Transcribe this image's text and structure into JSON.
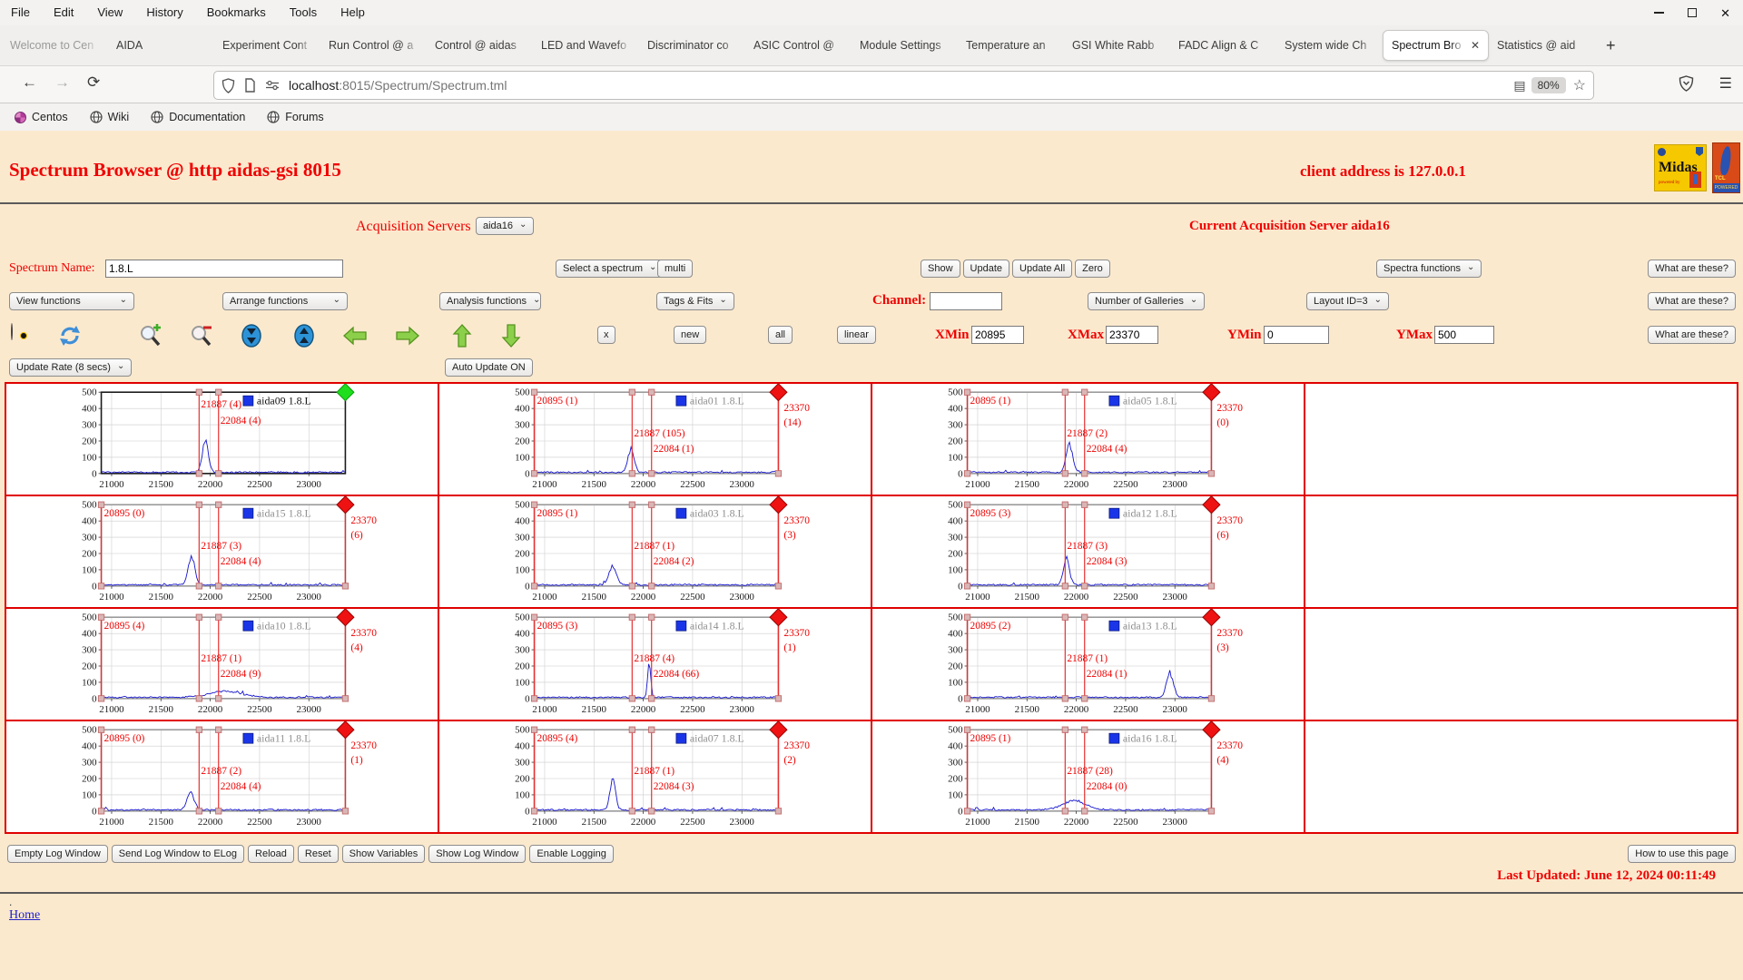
{
  "browser": {
    "menus": [
      "File",
      "Edit",
      "View",
      "History",
      "Bookmarks",
      "Tools",
      "Help"
    ],
    "tabs": [
      {
        "label": "Welcome to Cen",
        "muted": true
      },
      {
        "label": "AIDA"
      },
      {
        "label": "Experiment Cont"
      },
      {
        "label": "Run Control @ a"
      },
      {
        "label": "Control @ aidas"
      },
      {
        "label": "LED and Wavefo"
      },
      {
        "label": "Discriminator co"
      },
      {
        "label": "ASIC Control @"
      },
      {
        "label": "Module Settings"
      },
      {
        "label": "Temperature an"
      },
      {
        "label": "GSI White Rabb"
      },
      {
        "label": "FADC Align & C"
      },
      {
        "label": "System wide Ch"
      },
      {
        "label": "Spectrum Bro",
        "active": true
      },
      {
        "label": "Statistics @ aid"
      }
    ],
    "new_tab_label": "+",
    "url_domain": "localhost",
    "url_path": ":8015/Spectrum/Spectrum.tml",
    "zoom_badge": "80%",
    "bookmarks": [
      {
        "label": "Centos",
        "icon": "centos-flower-icon"
      },
      {
        "label": "Wiki",
        "icon": "globe-icon"
      },
      {
        "label": "Documentation",
        "icon": "globe-icon"
      },
      {
        "label": "Forums",
        "icon": "globe-icon"
      }
    ],
    "icon_names": [
      "back-arrow-icon",
      "forward-arrow-icon",
      "reload-icon",
      "shield-icon",
      "page-icon",
      "permissions-icon",
      "reader-mode-icon",
      "bookmark-star-icon",
      "pocket-icon",
      "menu-hamburger-icon",
      "minimize-icon",
      "maximize-icon",
      "close-icon"
    ]
  },
  "header": {
    "title": "Spectrum Browser @ http aidas-gsi 8015",
    "client_address": "client address is 127.0.0.1",
    "midas_logo_text": "Midas",
    "midas_powered": "powered by",
    "tcl_logo_text": "TCL",
    "tcl_powered": "POWERED"
  },
  "acquisition": {
    "label": "Acquisition Servers",
    "selected": "aida16",
    "current": "Current Acquisition Server aida16"
  },
  "spectrum_row": {
    "name_label": "Spectrum Name:",
    "name_value": "1.8.L",
    "select_spectrum": "Select a spectrum",
    "multi": "multi",
    "buttons": [
      "Show",
      "Update",
      "Update All",
      "Zero"
    ],
    "spectra_functions": "Spectra functions"
  },
  "function_row": {
    "view_functions": "View functions",
    "arrange_functions": "Arrange functions",
    "analysis_functions": "Analysis functions",
    "tags_fits": "Tags & Fits",
    "channel_label": "Channel:",
    "channel_value": "",
    "galleries": "Number of Galleries",
    "layout": "Layout ID=3"
  },
  "toolbar_row": {
    "icon_names": [
      "radiation-icon",
      "refresh-icon",
      "zoom-in-icon",
      "zoom-out-icon",
      "compress-vertical-icon",
      "expand-vertical-icon",
      "arrow-left-icon",
      "arrow-right-icon",
      "arrow-up-icon",
      "arrow-down-icon"
    ],
    "x_button": "x",
    "new_button": "new",
    "all_button": "all",
    "linear_button": "linear",
    "xmin_label": "XMin",
    "xmin": "20895",
    "xmax_label": "XMax",
    "xmax": "23370",
    "ymin_label": "YMin",
    "ymin": "0",
    "ymax_label": "YMax",
    "ymax": "500"
  },
  "what_are_these": "What are these?",
  "update_row": {
    "rate": "Update Rate (8 secs)",
    "auto": "Auto Update ON"
  },
  "chart_data": {
    "type": "line",
    "xlim": [
      20895,
      23370
    ],
    "ylim": [
      0,
      500
    ],
    "x_ticks": [
      21000,
      21500,
      22000,
      22500,
      23000
    ],
    "y_ticks": [
      0,
      100,
      200,
      300,
      400,
      500
    ],
    "marker_positions": [
      20895,
      21887,
      22084,
      23370
    ],
    "trace_color": "#1414cc",
    "marker_color": "#e83030",
    "label_color": "#ee0000",
    "panels": [
      {
        "legend": "aida09 1.8.L",
        "selected": true,
        "frame": "#1a1a1a",
        "diamond": "#1ede1e",
        "legend_color": "#111111",
        "labels": {
          "left": null,
          "line1": "21887 (4)",
          "line2": "22084 (4)",
          "right": null,
          "right_count": null
        },
        "peak": {
          "center": 21950,
          "height": 195,
          "sigma": 30
        }
      },
      {
        "legend": "aida01 1.8.L",
        "selected": false,
        "frame": "#9a9a9a",
        "diamond": "#ee1212",
        "legend_color": "#8f8f8f",
        "labels": {
          "left": "20895 (1)",
          "line1": "21887 (105)",
          "line2": "22084 (1)",
          "right": "23370",
          "right_count": "(14)"
        },
        "peak": {
          "center": 21875,
          "height": 140,
          "sigma": 32
        }
      },
      {
        "legend": "aida05 1.8.L",
        "selected": false,
        "frame": "#9a9a9a",
        "diamond": "#ee1212",
        "legend_color": "#8f8f8f",
        "labels": {
          "left": "20895 (1)",
          "line1": "21887 (2)",
          "line2": "22084 (4)",
          "right": "23370",
          "right_count": "(0)"
        },
        "peak": {
          "center": 21930,
          "height": 170,
          "sigma": 33
        }
      },
      {
        "legend": "aida15 1.8.L",
        "selected": false,
        "frame": "#9a9a9a",
        "diamond": "#ee1212",
        "legend_color": "#8f8f8f",
        "labels": {
          "left": "20895 (0)",
          "line1": "21887 (3)",
          "line2": "22084 (4)",
          "right": "23370",
          "right_count": "(6)"
        },
        "peak": {
          "center": 21810,
          "height": 175,
          "sigma": 33
        }
      },
      {
        "legend": "aida03 1.8.L",
        "selected": false,
        "frame": "#9a9a9a",
        "diamond": "#ee1212",
        "legend_color": "#8f8f8f",
        "labels": {
          "left": "20895 (1)",
          "line1": "21887 (1)",
          "line2": "22084 (2)",
          "right": "23370",
          "right_count": "(3)"
        },
        "peak": {
          "center": 21690,
          "height": 115,
          "sigma": 38
        }
      },
      {
        "legend": "aida12 1.8.L",
        "selected": false,
        "frame": "#9a9a9a",
        "diamond": "#ee1212",
        "legend_color": "#8f8f8f",
        "labels": {
          "left": "20895 (3)",
          "line1": "21887 (3)",
          "line2": "22084 (3)",
          "right": "23370",
          "right_count": "(6)"
        },
        "peak": {
          "center": 21900,
          "height": 160,
          "sigma": 30
        }
      },
      {
        "legend": "aida10 1.8.L",
        "selected": false,
        "frame": "#9a9a9a",
        "diamond": "#ee1212",
        "legend_color": "#8f8f8f",
        "labels": {
          "left": "20895 (4)",
          "line1": "21887 (1)",
          "line2": "22084 (9)",
          "right": "23370",
          "right_count": "(4)"
        },
        "peak": {
          "center": 22150,
          "height": 38,
          "sigma": 160
        }
      },
      {
        "legend": "aida14 1.8.L",
        "selected": false,
        "frame": "#9a9a9a",
        "diamond": "#ee1212",
        "legend_color": "#8f8f8f",
        "labels": {
          "left": "20895 (3)",
          "line1": "21887 (4)",
          "line2": "22084 (66)",
          "right": "23370",
          "right_count": "(1)"
        },
        "peak": {
          "center": 22060,
          "height": 195,
          "sigma": 16
        }
      },
      {
        "legend": "aida13 1.8.L",
        "selected": false,
        "frame": "#9a9a9a",
        "diamond": "#ee1212",
        "legend_color": "#8f8f8f",
        "labels": {
          "left": "20895 (2)",
          "line1": "21887 (1)",
          "line2": "22084 (1)",
          "right": "23370",
          "right_count": "(3)"
        },
        "peak": {
          "center": 22950,
          "height": 150,
          "sigma": 35
        }
      },
      {
        "legend": "aida11 1.8.L",
        "selected": false,
        "frame": "#9a9a9a",
        "diamond": "#ee1212",
        "legend_color": "#8f8f8f",
        "labels": {
          "left": "20895 (0)",
          "line1": "21887 (2)",
          "line2": "22084 (4)",
          "right": "23370",
          "right_count": "(1)"
        },
        "peak": {
          "center": 21800,
          "height": 110,
          "sigma": 35
        }
      },
      {
        "legend": "aida07 1.8.L",
        "selected": false,
        "frame": "#9a9a9a",
        "diamond": "#ee1212",
        "legend_color": "#8f8f8f",
        "labels": {
          "left": "20895 (4)",
          "line1": "21887 (1)",
          "line2": "22084 (3)",
          "right": "23370",
          "right_count": "(2)"
        },
        "peak": {
          "center": 21690,
          "height": 185,
          "sigma": 28
        }
      },
      {
        "legend": "aida16 1.8.L",
        "selected": false,
        "frame": "#9a9a9a",
        "diamond": "#ee1212",
        "legend_color": "#8f8f8f",
        "labels": {
          "left": "20895 (1)",
          "line1": "21887 (28)",
          "line2": "22084 (0)",
          "right": "23370",
          "right_count": "(4)"
        },
        "peak": {
          "center": 21980,
          "height": 55,
          "sigma": 120
        }
      }
    ]
  },
  "footer": {
    "buttons": [
      "Empty Log Window",
      "Send Log Window to ELog",
      "Reload",
      "Reset",
      "Show Variables",
      "Show Log Window",
      "Enable Logging"
    ],
    "help_button": "How to use this page",
    "last_updated": "Last Updated: June 12, 2024 00:11:49",
    "dot": ".",
    "home": "Home"
  }
}
